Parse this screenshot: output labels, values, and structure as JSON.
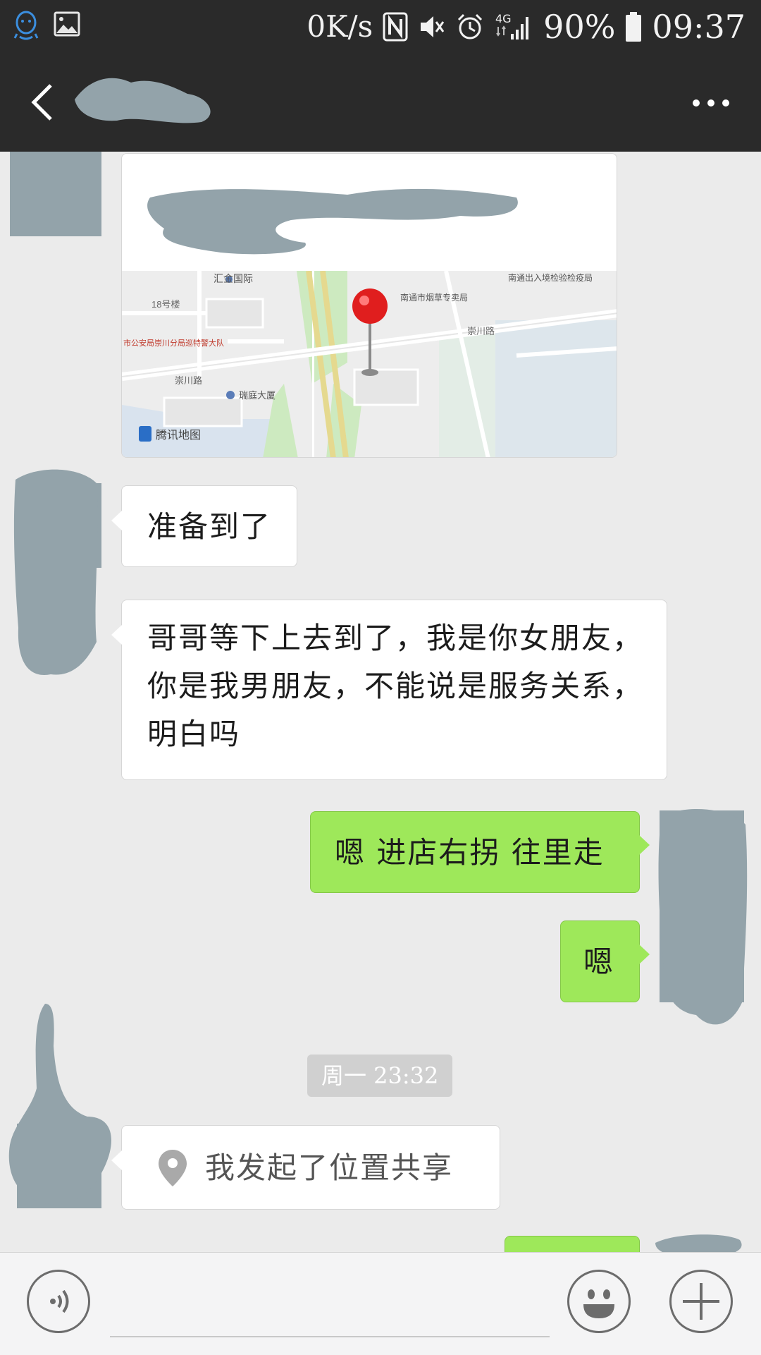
{
  "status_bar": {
    "network_speed": "0K/s",
    "signal_type": "4G",
    "battery_percent": "90%",
    "time": "09:37",
    "left_icons": [
      "qq-icon",
      "gallery-icon"
    ],
    "right_icons": [
      "nfc-icon",
      "mute-vibrate-icon",
      "alarm-icon",
      "signal-icon",
      "battery-icon"
    ]
  },
  "title_bar": {
    "contact_name": "",
    "back_icon": "chevron-left-icon",
    "more_icon": "more-dots-icon"
  },
  "messages": [
    {
      "side": "left",
      "type": "location",
      "place_name": "",
      "map_labels": {
        "label_1": "汇金国际",
        "label_2": "南通市烟草专卖局",
        "label_3": "南通出入境检验检疫局",
        "label_4": "18号楼",
        "label_5": "崇川路",
        "label_6": "崇川路",
        "label_7": "市公安局崇川分局巡特警大队",
        "label_8": "瑞庭大厦",
        "provider": "腾讯地图"
      }
    },
    {
      "side": "left",
      "type": "text",
      "text": "准备到了"
    },
    {
      "side": "left",
      "type": "text",
      "text": "哥哥等下上去到了，我是你女朋友，你是我男朋友，不能说是服务关系，明白吗"
    },
    {
      "side": "right",
      "type": "text",
      "text": "嗯 进店右拐 往里走"
    },
    {
      "side": "right",
      "type": "text",
      "text": "嗯"
    },
    {
      "side": "system",
      "type": "time",
      "text": "周一 23:32"
    },
    {
      "side": "left",
      "type": "location_share",
      "text": "我发起了位置共享",
      "icon": "location-pin-icon"
    }
  ],
  "input_bar": {
    "voice_icon": "voice-icon",
    "emoji_icon": "emoji-icon",
    "plus_icon": "plus-icon",
    "placeholder": ""
  },
  "colors": {
    "chat_background": "#ebebeb",
    "bar_background": "#2a2a2a",
    "incoming_bubble": "#ffffff",
    "outgoing_bubble": "#9ee85a",
    "redaction_gray": "#93a3aa"
  }
}
